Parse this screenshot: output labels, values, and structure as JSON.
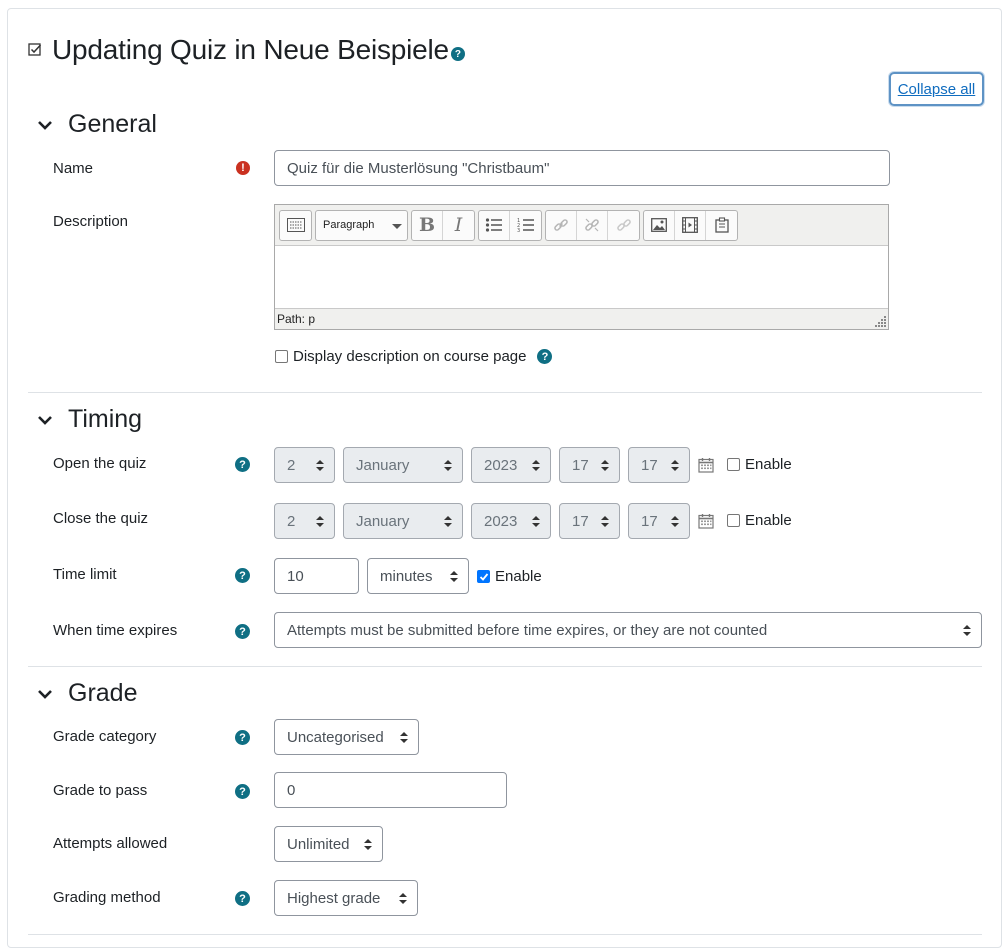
{
  "header": {
    "title": "Updating Quiz in Neue Beispiele",
    "collapse_all": "Collapse all"
  },
  "sections": {
    "general": "General",
    "timing": "Timing",
    "grade": "Grade"
  },
  "general": {
    "name_label": "Name",
    "name_value": "Quiz für die Musterlösung \"Christbaum\"",
    "description_label": "Description",
    "editor": {
      "format": "Paragraph",
      "path": "Path: p"
    },
    "display_desc": "Display description on course page"
  },
  "timing": {
    "open_label": "Open the quiz",
    "close_label": "Close the quiz",
    "open": {
      "day": "2",
      "month": "January",
      "year": "2023",
      "hour": "17",
      "minute": "17",
      "enable": "Enable",
      "enabled": false
    },
    "close": {
      "day": "2",
      "month": "January",
      "year": "2023",
      "hour": "17",
      "minute": "17",
      "enable": "Enable",
      "enabled": false
    },
    "time_limit_label": "Time limit",
    "time_limit_value": "10",
    "time_limit_unit": "minutes",
    "time_limit_enable": "Enable",
    "time_limit_enabled": true,
    "expires_label": "When time expires",
    "expires_value": "Attempts must be submitted before time expires, or they are not counted"
  },
  "grade": {
    "category_label": "Grade category",
    "category_value": "Uncategorised",
    "pass_label": "Grade to pass",
    "pass_value": "0",
    "attempts_label": "Attempts allowed",
    "attempts_value": "Unlimited",
    "method_label": "Grading method",
    "method_value": "Highest grade"
  },
  "colors": {
    "help_icon": "#0f6f84",
    "error_icon": "#ca3120",
    "link": "#0f6cbf",
    "checkbox_on": "#0075ff"
  }
}
